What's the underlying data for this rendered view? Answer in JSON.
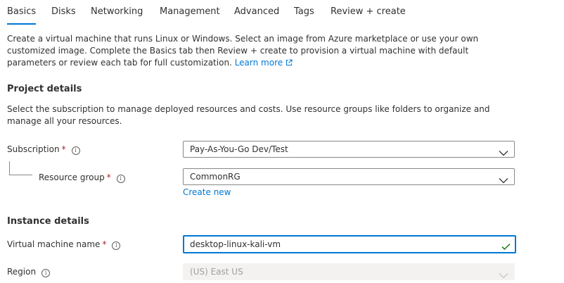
{
  "tabs": [
    {
      "label": "Basics",
      "active": true
    },
    {
      "label": "Disks",
      "active": false
    },
    {
      "label": "Networking",
      "active": false
    },
    {
      "label": "Management",
      "active": false
    },
    {
      "label": "Advanced",
      "active": false
    },
    {
      "label": "Tags",
      "active": false
    },
    {
      "label": "Review + create",
      "active": false
    }
  ],
  "intro": {
    "text": "Create a virtual machine that runs Linux or Windows. Select an image from Azure marketplace or use your own customized image. Complete the Basics tab then Review + create to provision a virtual machine with default parameters or review each tab for full customization.",
    "learn_more": "Learn more"
  },
  "project_details": {
    "title": "Project details",
    "description": "Select the subscription to manage deployed resources and costs. Use resource groups like folders to organize and manage all your resources.",
    "subscription": {
      "label": "Subscription",
      "required_mark": "*",
      "value": "Pay-As-You-Go Dev/Test"
    },
    "resource_group": {
      "label": "Resource group",
      "required_mark": "*",
      "value": "CommonRG",
      "create_new": "Create new"
    }
  },
  "instance_details": {
    "title": "Instance details",
    "vm_name": {
      "label": "Virtual machine name",
      "required_mark": "*",
      "value": "desktop-linux-kali-vm"
    },
    "region": {
      "label": "Region",
      "value": "(US) East US"
    }
  },
  "icons": {
    "info": "info-icon",
    "chevron": "chevron-down-icon",
    "check": "check-icon",
    "external_link": "external-link-icon"
  },
  "colors": {
    "accent": "#0078d4",
    "required": "#a4262c",
    "valid": "#107c10",
    "text": "#323130"
  }
}
